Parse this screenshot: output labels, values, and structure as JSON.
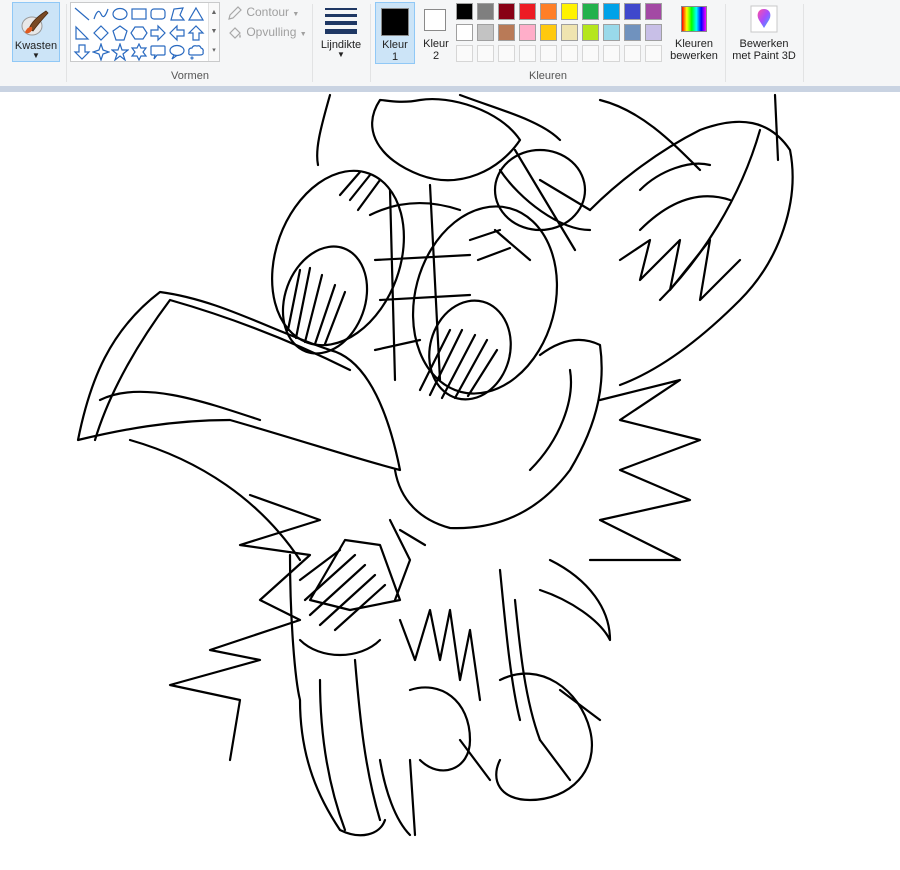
{
  "ribbon": {
    "brushes": {
      "label": "Kwasten",
      "icon": "paintbrush-icon"
    },
    "shapes": {
      "group_label": "Vormen",
      "items": [
        "line-shape-icon",
        "curve-shape-icon",
        "oval-shape-icon",
        "rectangle-shape-icon",
        "rounded-rectangle-shape-icon",
        "polygon-shape-icon",
        "triangle-shape-icon",
        "right-triangle-shape-icon",
        "diamond-shape-icon",
        "pentagon-shape-icon",
        "hexagon-shape-icon",
        "right-arrow-shape-icon",
        "left-arrow-shape-icon",
        "up-arrow-shape-icon",
        "down-arrow-shape-icon",
        "four-point-star-shape-icon",
        "five-point-star-shape-icon",
        "six-point-star-shape-icon",
        "rounded-callout-shape-icon",
        "oval-callout-shape-icon",
        "cloud-callout-shape-icon"
      ],
      "contour_label": "Contour",
      "fill_label": "Opvulling"
    },
    "line_width": {
      "label": "Lijndikte"
    },
    "colors": {
      "group_label": "Kleuren",
      "color1": {
        "label_line1": "Kleur",
        "label_line2": "1",
        "value": "#000000"
      },
      "color2": {
        "label_line1": "Kleur",
        "label_line2": "2",
        "value": "#ffffff"
      },
      "palette_row1": [
        "#000000",
        "#7f7f7f",
        "#880015",
        "#ed1c24",
        "#ff7f27",
        "#fff200",
        "#22b14c",
        "#00a2e8",
        "#3f48cc",
        "#a349a4"
      ],
      "palette_row2": [
        "#ffffff",
        "#c3c3c3",
        "#b97a57",
        "#ffaec9",
        "#ffc90e",
        "#efe4b0",
        "#b5e61d",
        "#99d9ea",
        "#7092be",
        "#c8bfe7"
      ],
      "palette_row3_count": 10,
      "edit_colors": {
        "label_line1": "Kleuren",
        "label_line2": "bewerken"
      }
    },
    "paint3d": {
      "label_line1": "Bewerken",
      "label_line2": "met Paint 3D"
    }
  },
  "theme": {
    "selected_bg": "#cce4f7",
    "selected_border": "#90c8f6",
    "canvas_surround": "#c9d3e2"
  }
}
